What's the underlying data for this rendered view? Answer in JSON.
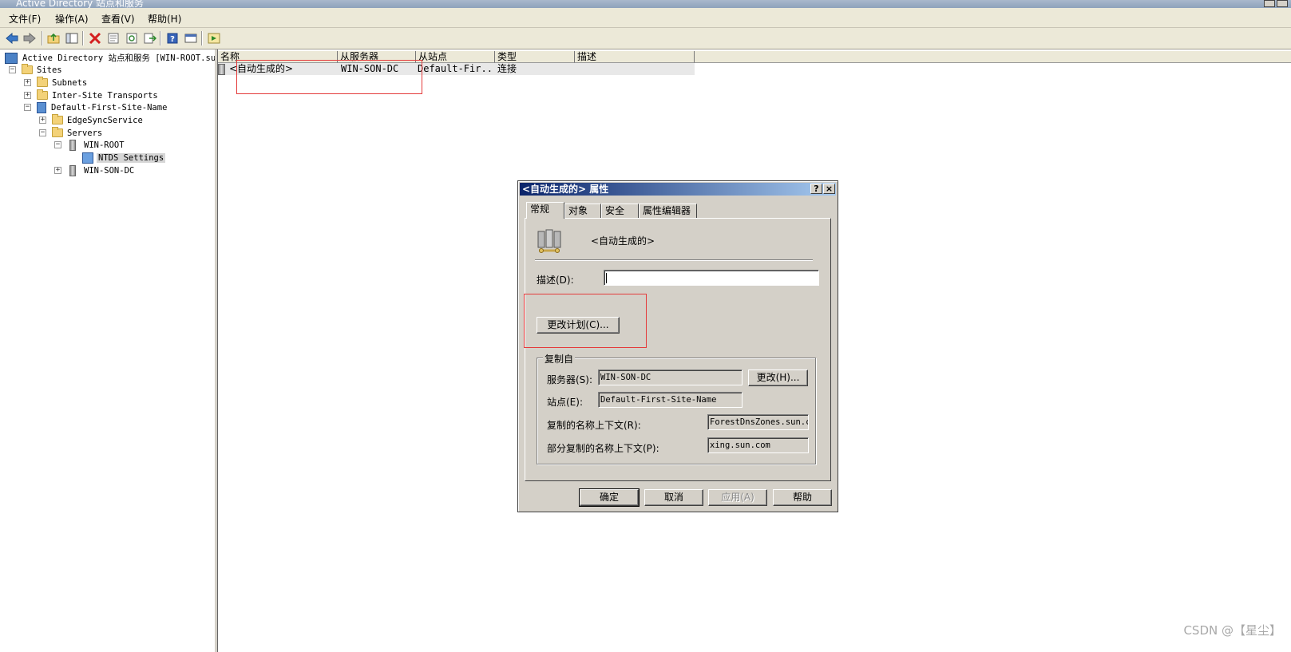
{
  "window": {
    "title": "Active Directory 站点和服务"
  },
  "menu": [
    "文件(F)",
    "操作(A)",
    "查看(V)",
    "帮助(H)"
  ],
  "toolbar": {
    "icons": [
      "back-icon",
      "forward-icon",
      "up-folder-icon",
      "show-tree-icon",
      "delete-icon",
      "properties-icon",
      "refresh-icon",
      "export-icon",
      "help-icon",
      "view-icon",
      "run-icon"
    ]
  },
  "tree": {
    "root": "Active Directory 站点和服务 [WIN-ROOT.su",
    "sites": "Sites",
    "subnets": "Subnets",
    "inter_site": "Inter-Site Transports",
    "default_site": "Default-First-Site-Name",
    "edgesync": "EdgeSyncService",
    "servers": "Servers",
    "win_root": "WIN-ROOT",
    "ntds": "NTDS Settings",
    "win_son": "WIN-SON-DC"
  },
  "list": {
    "columns": [
      "名称",
      "从服务器",
      "从站点",
      "类型",
      "描述"
    ],
    "rows": [
      {
        "name": "<自动生成的>",
        "from_server": "WIN-SON-DC",
        "from_site": "Default-Fir...",
        "type": "连接",
        "desc": ""
      }
    ]
  },
  "dialog": {
    "title": "<自动生成的> 属性",
    "help_btn": "?",
    "close_btn": "×",
    "tabs": [
      "常规",
      "对象",
      "安全",
      "属性编辑器"
    ],
    "object_name": "<自动生成的>",
    "desc_label": "描述(D):",
    "desc_value": "",
    "schedule_btn": "更改计划(C)...",
    "group_title": "复制自",
    "server_label": "服务器(S):",
    "server_value": "WIN-SON-DC",
    "change_btn": "更改(H)...",
    "site_label": "站点(E):",
    "site_value": "Default-First-Site-Name",
    "naming_ctx_label": "复制的名称上下文(R):",
    "naming_ctx_value": "ForestDnsZones.sun.co",
    "partial_ctx_label": "部分复制的名称上下文(P):",
    "partial_ctx_value": "xing.sun.com",
    "ok_btn": "确定",
    "cancel_btn": "取消",
    "apply_btn": "应用(A)",
    "help_btn2": "帮助"
  },
  "watermark": "CSDN @【星尘】",
  "colors": {
    "highlight_box": "#e43b3b",
    "title_active": "#0a246a"
  }
}
